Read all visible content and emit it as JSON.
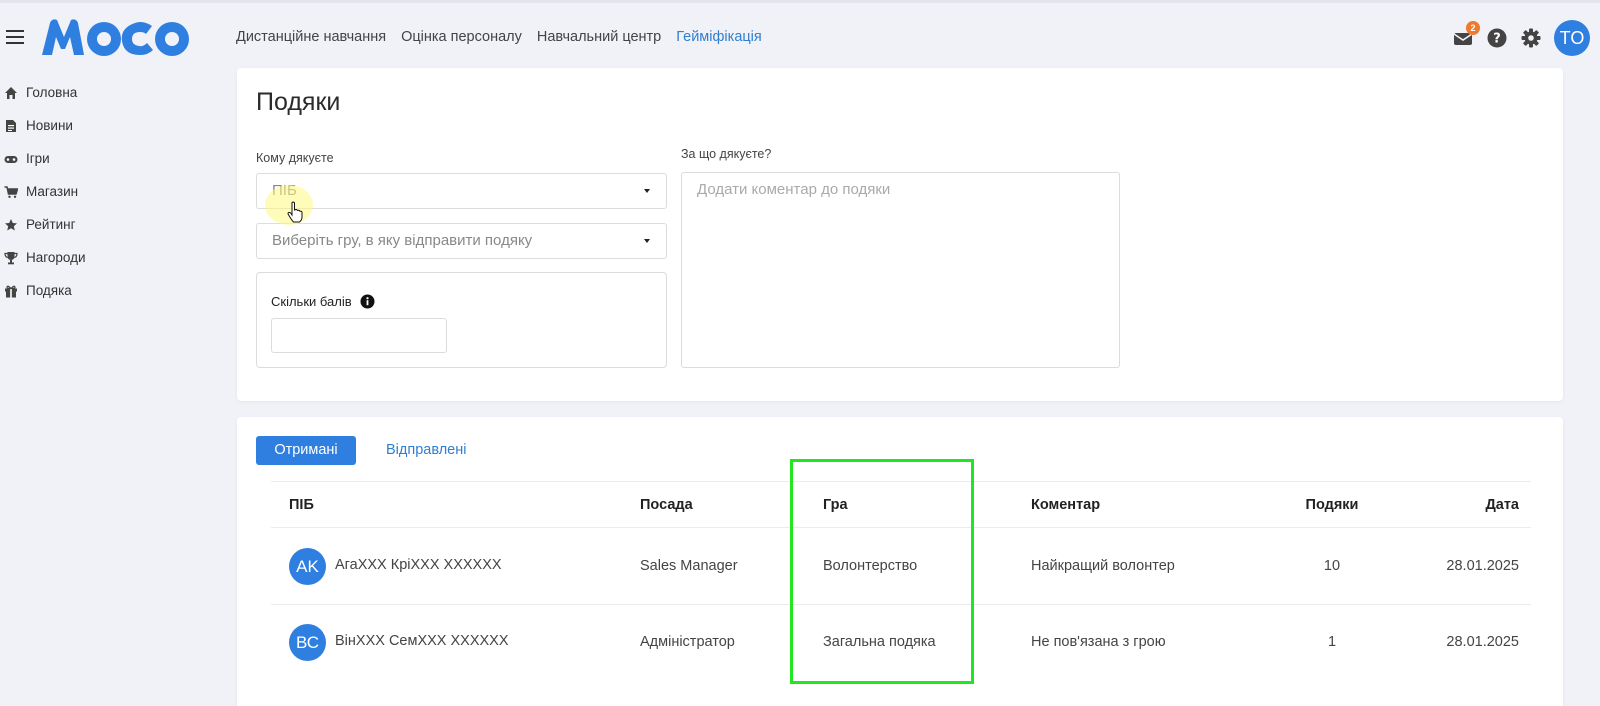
{
  "brand": {
    "logo_text": "MOCO",
    "color": "#2f7fe0"
  },
  "topnav": {
    "items": [
      {
        "label": "Дистанційне навчання"
      },
      {
        "label": "Оцінка персоналу"
      },
      {
        "label": "Навчальний центр"
      },
      {
        "label": "Гейміфікація",
        "active": true
      }
    ]
  },
  "header_icons": {
    "mail_badge": "2",
    "user_initials": "TO"
  },
  "sidebar": {
    "items": [
      {
        "label": "Головна",
        "icon": "home-icon"
      },
      {
        "label": "Новини",
        "icon": "news-icon"
      },
      {
        "label": "Ігри",
        "icon": "gamepad-icon"
      },
      {
        "label": "Магазин",
        "icon": "cart-icon"
      },
      {
        "label": "Рейтинг",
        "icon": "star-icon"
      },
      {
        "label": "Нагороди",
        "icon": "trophy-icon"
      },
      {
        "label": "Подяка",
        "icon": "gift-icon"
      }
    ]
  },
  "form": {
    "title": "Подяки",
    "whom_label": "Кому дякуєте",
    "whom_placeholder": "ПІБ",
    "game_placeholder": "Виберіть гру, в яку відправити подяку",
    "points_label": "Скільки балів",
    "points_value": "",
    "reason_label": "За що дякуєте?",
    "comment_placeholder": "Додати коментар до подяки"
  },
  "tabs": {
    "received": "Отримані",
    "sent": "Відправлені"
  },
  "table": {
    "headers": [
      "ПІБ",
      "Посада",
      "Гра",
      "Коментар",
      "Подяки",
      "Дата"
    ],
    "rows": [
      {
        "initials": "AK",
        "name": "АгаXXX КріXXX XXXXXX",
        "position": "Sales Manager",
        "game": "Волонтерство",
        "comment": "Найкращий волонтер",
        "count": "10",
        "date": "28.01.2025"
      },
      {
        "initials": "ВС",
        "name": "ВінXXX СемXXX XXXXXX",
        "position": "Адміністратор",
        "game": "Загальна подяка",
        "comment": "Не пов'язана з грою",
        "count": "1",
        "date": "28.01.2025"
      }
    ]
  },
  "colors": {
    "accent": "#2f7fe0",
    "highlight_box": "#22e622",
    "badge": "#f07a2c"
  }
}
